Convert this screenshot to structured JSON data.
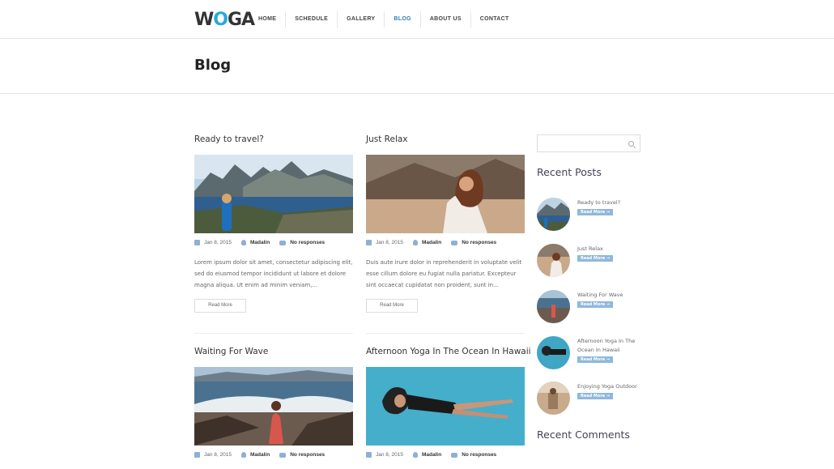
{
  "header": {
    "logo_text_1": "W",
    "logo_text_2": "O",
    "logo_text_3": "GA",
    "nav": [
      "HOME",
      "SCHEDULE",
      "GALLERY",
      "BLOG",
      "ABOUT US",
      "CONTACT"
    ],
    "active_nav": "BLOG"
  },
  "page": {
    "title": "Blog"
  },
  "posts": [
    {
      "title": "Ready to travel?",
      "date": "Jan 8, 2015",
      "author": "Madalin",
      "comments": "No responses",
      "excerpt": "Lorem ipsum dolor sit amet, consectetur adipiscing elit, sed do eiusmod tempor incididunt ut labore et dolore magna aliqua. Ut enim ad minim veniam,...",
      "read_more": "Read More"
    },
    {
      "title": "Just Relax",
      "date": "Jan 8, 2015",
      "author": "Madalin",
      "comments": "No responses",
      "excerpt": "Duis aute irure dolor in reprehenderit in voluptate velit esse cillum dolore eu fugiat nulla pariatur. Excepteur sint occaecat cupidatat non proident, sunt in...",
      "read_more": "Read More"
    },
    {
      "title": "Waiting For Wave",
      "date": "Jan 8, 2015",
      "author": "Madalin",
      "comments": "No responses"
    },
    {
      "title": "Afternoon Yoga In The Ocean In Hawaii",
      "date": "Jan 8, 2015",
      "author": "Madalin",
      "comments": "No responses"
    }
  ],
  "sidebar": {
    "search_placeholder": "",
    "recent_posts_title": "Recent Posts",
    "recent_posts": [
      {
        "title": "Ready to travel?",
        "button": "Read More →"
      },
      {
        "title": "Just Relax",
        "button": "Read More →"
      },
      {
        "title": "Waiting For Wave",
        "button": "Read More →"
      },
      {
        "title": "Afternoon Yoga In The Ocean In Hawaii",
        "button": "Read More →"
      },
      {
        "title": "Enjoying Yoga Outdoor",
        "button": "Read More →"
      }
    ],
    "recent_comments_title": "Recent Comments"
  },
  "colors": {
    "accent": "#2b7fc0",
    "logo_accent": "#2aa8d8",
    "badge": "#8fb8dc"
  }
}
